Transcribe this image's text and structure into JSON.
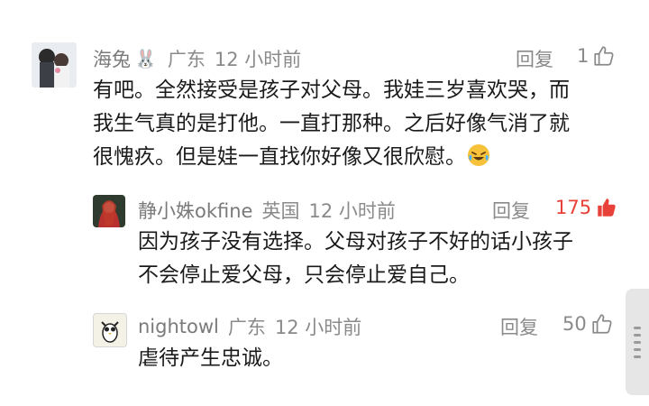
{
  "colors": {
    "accent_red": "#e8413a",
    "meta_gray": "#8a8a8a",
    "text": "#1a1a1a"
  },
  "comments": [
    {
      "name": "海兔",
      "name_icon": "rabbit-emoji-icon",
      "location": "广东",
      "time": "12 小时前",
      "reply_label": "回复",
      "like_count": "1",
      "lines": [
        "有吧。全然接受是孩子对父母。我娃三岁喜欢哭，而",
        "我生气真的是打他。一直打那种。之后好像气消了就",
        "很愧疚。但是娃一直找你好像又很欣慰。"
      ],
      "trailing_icon": "crying-laughing-emoji-icon"
    },
    {
      "name": "静小姝okfine",
      "location": "英国",
      "time": "12 小时前",
      "reply_label": "回复",
      "like_count": "175",
      "liked": true,
      "lines": [
        "因为孩子没有选择。父母对孩子不好的话小孩子",
        "不会停止爱父母，只会停止爱自己。"
      ]
    },
    {
      "name": "nightowl",
      "location": "广东",
      "time": "12 小时前",
      "reply_label": "回复",
      "like_count": "50",
      "lines": [
        "虐待产生忠诚。"
      ]
    }
  ]
}
